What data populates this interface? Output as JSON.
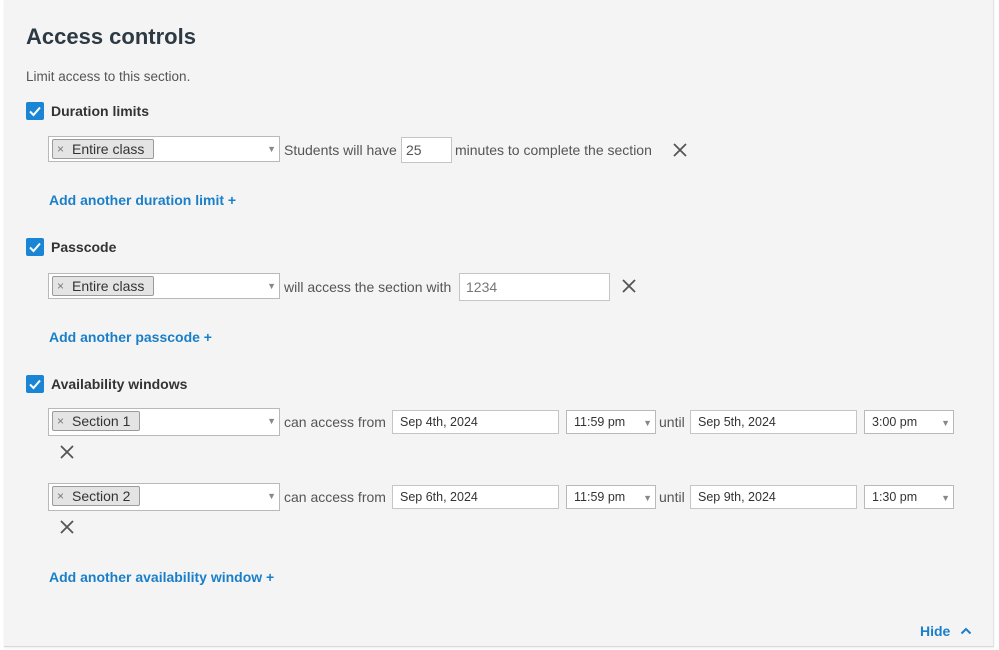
{
  "header": {
    "title": "Access controls",
    "description": "Limit access to this section."
  },
  "duration": {
    "label": "Duration limits",
    "tag": "Entire class",
    "prefix": "Students will have",
    "minutes": "25",
    "suffix": "minutes to complete the section",
    "add_link": "Add another duration limit +"
  },
  "passcode": {
    "label": "Passcode",
    "tag": "Entire class",
    "text": "will access the section with",
    "placeholder": "1234",
    "add_link": "Add another passcode +"
  },
  "availability": {
    "label": "Availability windows",
    "access_text": "can access from",
    "until_text": "until",
    "rows": [
      {
        "tag": "Section 1",
        "from_date": "Sep 4th, 2024",
        "from_time": "11:59 pm",
        "to_date": "Sep 5th, 2024",
        "to_time": "3:00 pm"
      },
      {
        "tag": "Section 2",
        "from_date": "Sep 6th, 2024",
        "from_time": "11:59 pm",
        "to_date": "Sep 9th, 2024",
        "to_time": "1:30 pm"
      }
    ],
    "add_link": "Add another availability window +"
  },
  "footer": {
    "hide_label": "Hide"
  },
  "colors": {
    "accent": "#1a85d4",
    "link": "#1a7fc9",
    "panel_bg": "#f4f4f4"
  },
  "icons": {
    "checkbox": "check-icon",
    "remove": "close-icon",
    "tag_remove": "tag-remove-icon",
    "dropdown": "chevron-down-icon",
    "collapse": "chevron-up-icon"
  }
}
